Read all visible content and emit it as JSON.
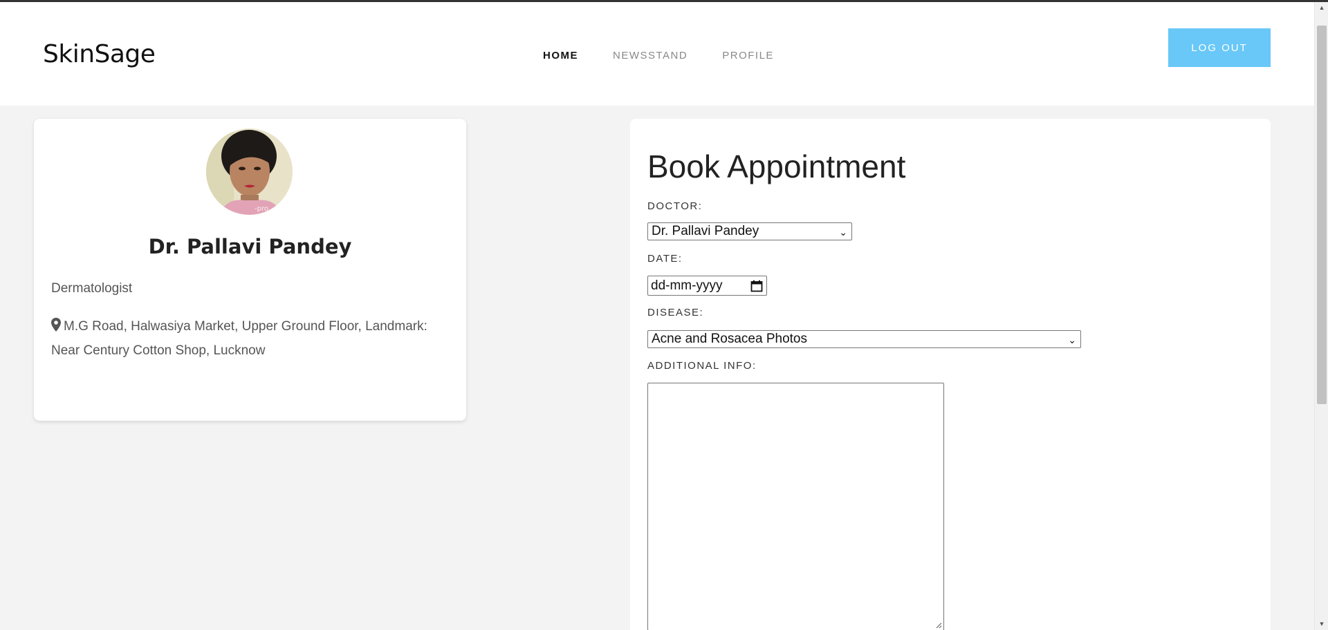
{
  "brand": {
    "name": "SkinSage"
  },
  "nav": {
    "items": [
      {
        "label": "HOME",
        "active": true
      },
      {
        "label": "NEWSSTAND",
        "active": false
      },
      {
        "label": "PROFILE",
        "active": false
      }
    ]
  },
  "header": {
    "logout_label": "LOG OUT"
  },
  "doctor": {
    "name": "Dr. Pallavi Pandey",
    "specialty": "Dermatologist",
    "address": "M.G Road, Halwasiya Market, Upper Ground Floor, Landmark: Near Century Cotton Shop, Lucknow"
  },
  "appointment": {
    "title": "Book Appointment",
    "doctor_label": "DOCTOR:",
    "doctor_value": "Dr. Pallavi Pandey",
    "date_label": "DATE:",
    "date_placeholder": "dd-mm-yyyy",
    "disease_label": "DISEASE:",
    "disease_value": "Acne and Rosacea Photos",
    "info_label": "ADDITIONAL INFO:",
    "info_value": ""
  },
  "colors": {
    "accent": "#69c8f7",
    "page_bg": "#f3f3f3",
    "card_bg": "#ffffff"
  },
  "icons": {
    "location": "map-pin-icon",
    "calendar": "calendar-icon",
    "dropdown": "chevron-down-icon"
  }
}
